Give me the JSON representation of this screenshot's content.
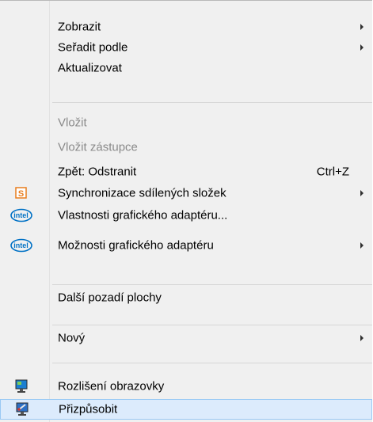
{
  "menu": {
    "items": [
      {
        "label": "Zobrazit",
        "submenu": true
      },
      {
        "label": "Seřadit podle",
        "submenu": true
      },
      {
        "label": "Aktualizovat"
      },
      {
        "label": "Vložit",
        "disabled": true
      },
      {
        "label": "Vložit zástupce",
        "disabled": true
      },
      {
        "label": "Zpět: Odstranit",
        "shortcut": "Ctrl+Z"
      },
      {
        "label": "Synchronizace sdílených složek",
        "submenu": true,
        "icon": "sync-folder-icon"
      },
      {
        "label": "Vlastnosti grafického adaptéru...",
        "icon": "intel-icon"
      },
      {
        "label": "Možnosti grafického adaptéru",
        "submenu": true,
        "icon": "intel-icon"
      },
      {
        "label": "Další pozadí plochy"
      },
      {
        "label": "Nový",
        "submenu": true
      },
      {
        "label": "Rozlišení obrazovky",
        "icon": "monitor-icon"
      },
      {
        "label": "Přizpůsobit",
        "icon": "personalize-icon",
        "highlighted": true
      }
    ]
  },
  "intel_logo_text": "intel",
  "sync_icon_letter": "S",
  "colors": {
    "menu_background": "#f0f0f0",
    "highlight_background": "#dcebfc",
    "highlight_border": "#99c9f4",
    "disabled_text": "#8a8a8a",
    "intel_blue": "#0071c5",
    "sync_orange": "#e87d1e"
  }
}
